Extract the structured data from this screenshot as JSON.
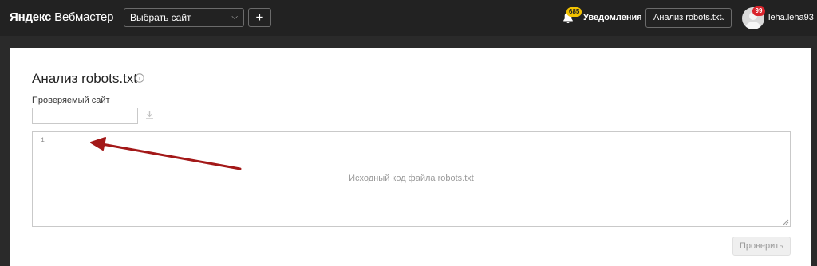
{
  "header": {
    "logo_brand": "Яндекс",
    "logo_product": "Вебмастер",
    "site_select_label": "Выбрать сайт",
    "add_site_label": "+",
    "notifications": {
      "count": "685",
      "label": "Уведомления"
    },
    "tool_select_label": "Анализ robots.txt",
    "user": {
      "badge_count": "99",
      "name": "leha.leha93"
    }
  },
  "main": {
    "title": "Анализ robots.txt",
    "site_field_label": "Проверяемый сайт",
    "site_field_value": "",
    "editor": {
      "line_number": "1",
      "placeholder": "Исходный код файла robots.txt"
    },
    "check_button_label": "Проверить"
  },
  "colors": {
    "topbar_bg": "#222222",
    "page_bg": "#2a2a2a",
    "notification_badge": "#f2c200",
    "avatar_badge": "#d9242c",
    "annotation_arrow": "#a31818"
  },
  "icons": [
    "chevron-down-icon",
    "bell-icon",
    "info-icon",
    "download-icon",
    "user-avatar-icon"
  ]
}
